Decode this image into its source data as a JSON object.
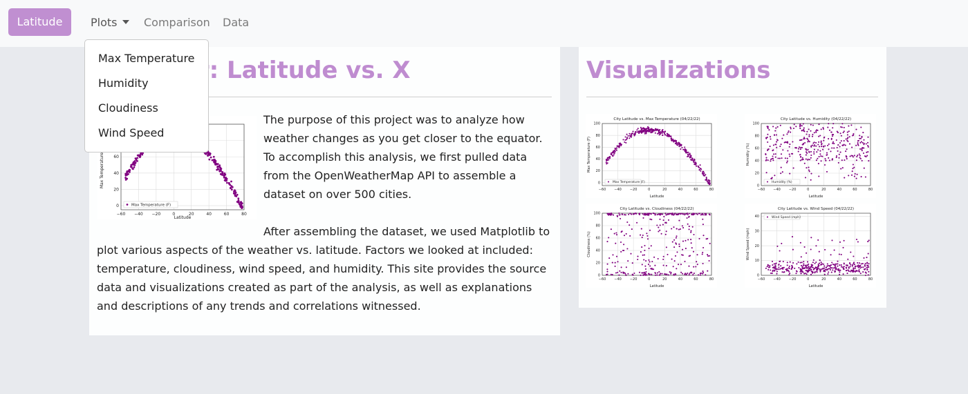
{
  "navbar": {
    "brand": "Latitude",
    "plots_label": "Plots",
    "comparison_label": "Comparison",
    "data_label": "Data"
  },
  "dropdown": {
    "items": [
      "Max Temperature",
      "Humidity",
      "Cloudiness",
      "Wind Speed"
    ]
  },
  "main": {
    "heading": "Weather: Latitude vs. X",
    "paragraph1": "The purpose of this project was to analyze how weather changes as you get closer to the equator. To accomplish this analysis, we first pulled data from the OpenWeatherMap API to assemble a dataset on over 500 cities.",
    "paragraph2": "After assembling the dataset, we used Matplotlib to plot various aspects of the weather vs. latitude. Factors we looked at included: temperature, cloudiness, wind speed, and humidity. This site provides the source data and visualizations created as part of the analysis, as well as explanations and descriptions of any trends and correlations witnessed."
  },
  "visualizations": {
    "heading": "Visualizations"
  },
  "colors": {
    "accent": "#bf8cd0",
    "brand_bg": "#c08fd1",
    "points": "#800080"
  },
  "chart_data": [
    {
      "type": "scatter",
      "title": "City Latitude vs. Max Temperature (04/22/22)",
      "xlabel": "Latitude",
      "ylabel": "Max Temperature (F)",
      "legend": "Max Temperature (F)",
      "xlim": [
        -60,
        80
      ],
      "ylim": [
        -5,
        100
      ],
      "xticks": [
        -60,
        -40,
        -20,
        0,
        20,
        40,
        60,
        80
      ],
      "yticks": [
        0,
        20,
        40,
        60,
        80,
        100
      ],
      "trend": "peaks near 0–20 latitude around 85–90, falls toward 0 at high latitudes"
    },
    {
      "type": "scatter",
      "title": "City Latitude vs. Humidity (04/22/22)",
      "xlabel": "Latitude",
      "ylabel": "Humidity (%)",
      "legend": "Humidity (%)",
      "xlim": [
        -60,
        80
      ],
      "ylim": [
        0,
        100
      ],
      "xticks": [
        -60,
        -40,
        -20,
        0,
        20,
        40,
        60,
        80
      ],
      "yticks": [
        0,
        20,
        40,
        60,
        80,
        100
      ]
    },
    {
      "type": "scatter",
      "title": "City Latitude vs. Cloudiness (04/22/22)",
      "xlabel": "Latitude",
      "ylabel": "Cloudiness (%)",
      "xlim": [
        -60,
        80
      ],
      "ylim": [
        0,
        100
      ],
      "xticks": [
        -60,
        -40,
        -20,
        0,
        20,
        40,
        60,
        80
      ],
      "yticks": [
        0,
        20,
        40,
        60,
        80,
        100
      ]
    },
    {
      "type": "scatter",
      "title": "City Latitude vs. Wind Speed (04/22/22)",
      "xlabel": "Latitude",
      "ylabel": "Wind Speed (mph)",
      "legend": "Wind Speed (mph)",
      "xlim": [
        -60,
        80
      ],
      "ylim": [
        0,
        42
      ],
      "xticks": [
        -60,
        -40,
        -20,
        0,
        20,
        40,
        60,
        80
      ],
      "yticks": [
        0,
        10,
        20,
        30,
        40
      ]
    }
  ]
}
